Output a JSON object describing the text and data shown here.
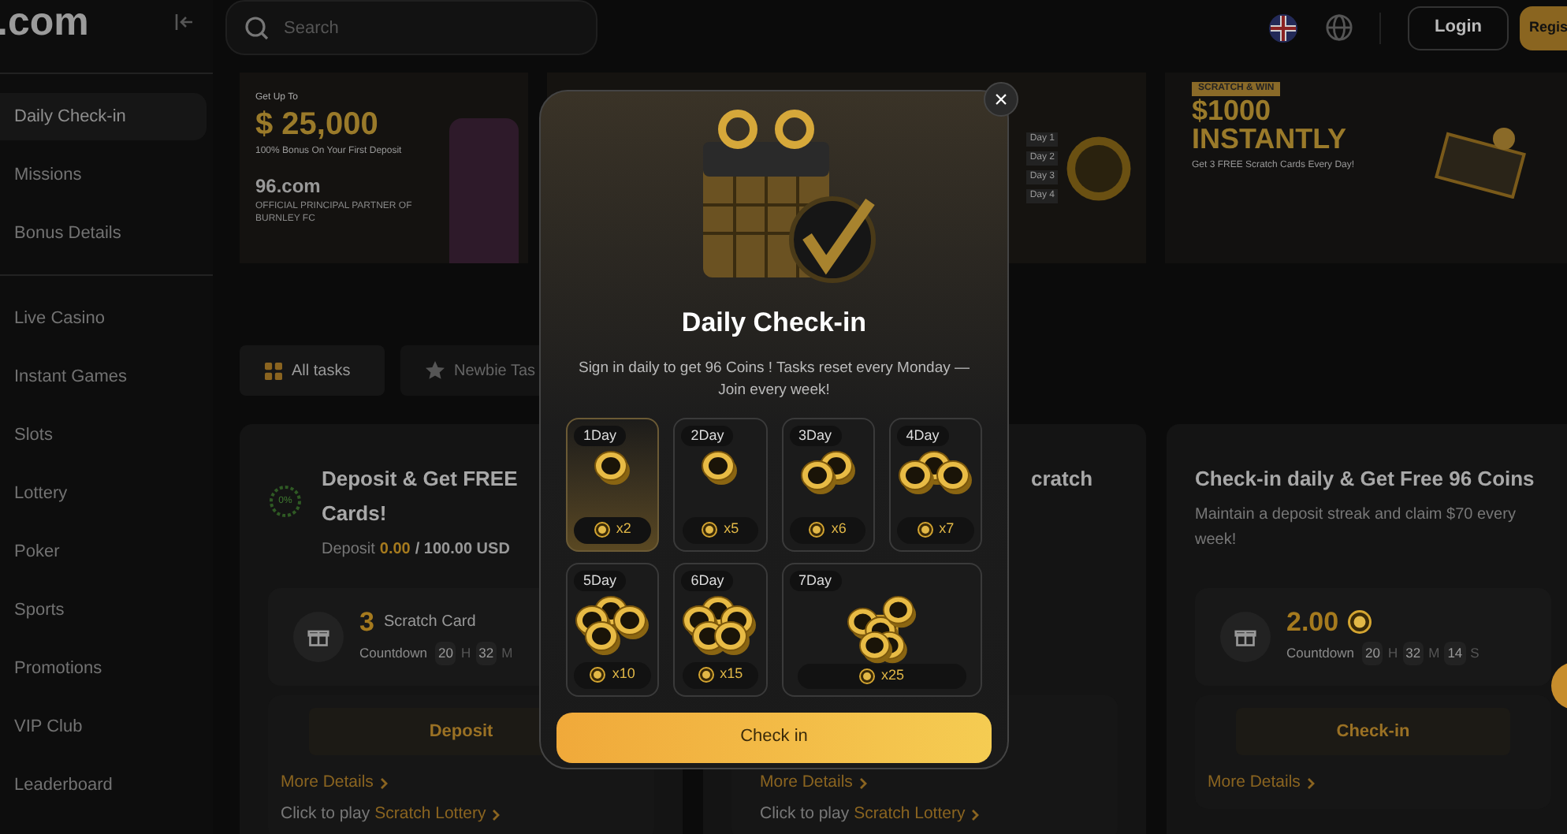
{
  "header": {
    "logo": ".com",
    "search": {
      "placeholder": "Search"
    },
    "login": "Login",
    "register": "Regis"
  },
  "sidebar": {
    "groups": [
      [
        {
          "label": "Daily Check-in",
          "selected": true
        },
        {
          "label": "Missions",
          "selected": false
        },
        {
          "label": "Bonus Details",
          "selected": false
        }
      ],
      [
        {
          "label": "Live Casino",
          "selected": false
        },
        {
          "label": "Instant Games",
          "selected": false
        },
        {
          "label": "Slots",
          "selected": false
        },
        {
          "label": "Lottery",
          "selected": false
        },
        {
          "label": "Poker",
          "selected": false
        },
        {
          "label": "Sports",
          "selected": false
        },
        {
          "label": "Promotions",
          "selected": false
        },
        {
          "label": "VIP Club",
          "selected": false
        },
        {
          "label": "Leaderboard",
          "selected": false
        }
      ]
    ]
  },
  "banners": {
    "first": {
      "eyebrow": "Get Up To",
      "amount": "$ 25,000",
      "subtitle": "100% Bonus On Your First Deposit",
      "brand": "96.com",
      "partner": "OFFICIAL PRINCIPAL PARTNER OF BURNLEY FC"
    },
    "second": {
      "days": [
        "Day 1",
        "Day 2",
        "Day 3",
        "Day 4"
      ]
    },
    "third": {
      "tag": "SCRATCH & WIN",
      "amount": "$1000",
      "headline": "INSTANTLY",
      "subtitle": "Get 3 FREE Scratch Cards Every Day!"
    }
  },
  "tabs": [
    {
      "label": "All tasks",
      "selected": true
    },
    {
      "label": "Newbie Tas",
      "selected": false
    }
  ],
  "cards": [
    {
      "title": "Deposit & Get FREE Cards!",
      "progress": {
        "ring": "0%",
        "label": "Deposit",
        "current": "0.00",
        "total": "/ 100.00 USD"
      },
      "reward": {
        "amount": "3",
        "unit": "Scratch Card",
        "kind": "cards"
      },
      "countdown": {
        "label": "Countdown",
        "parts": [
          {
            "value": "20",
            "unit": "H"
          },
          {
            "value": "32",
            "unit": "M"
          }
        ]
      },
      "action": "Deposit",
      "more": "More Details",
      "play": {
        "prefix": "Click to play",
        "link": "Scratch Lottery"
      }
    },
    {
      "title": "cratch",
      "more": "More Details",
      "play": {
        "prefix": "Click to play",
        "link": "Scratch Lottery"
      }
    },
    {
      "title": "Check-in daily & Get Free 96 Coins",
      "description": "Maintain a deposit streak and claim $70 every week!",
      "reward": {
        "amount": "2.00",
        "kind": "coins"
      },
      "countdown": {
        "label": "Countdown",
        "parts": [
          {
            "value": "20",
            "unit": "H"
          },
          {
            "value": "32",
            "unit": "M"
          },
          {
            "value": "14",
            "unit": "S"
          }
        ]
      },
      "action": "Check-in",
      "more": "More Details"
    }
  ],
  "modal": {
    "close": "×",
    "title": "Daily Check-in",
    "description": "Sign in daily to get 96 Coins ! Tasks reset every Monday — Join every week!",
    "days": [
      {
        "label": "1Day",
        "reward": "x2",
        "kind": "small",
        "selected": true
      },
      {
        "label": "2Day",
        "reward": "x5",
        "kind": "small",
        "selected": false
      },
      {
        "label": "3Day",
        "reward": "x6",
        "kind": "small",
        "selected": false
      },
      {
        "label": "4Day",
        "reward": "x7",
        "kind": "small",
        "selected": false
      },
      {
        "label": "5Day",
        "reward": "x10",
        "kind": "small",
        "selected": false
      },
      {
        "label": "6Day",
        "reward": "x15",
        "kind": "small",
        "selected": false
      },
      {
        "label": "7Day",
        "reward": "x25",
        "kind": "large",
        "selected": false
      }
    ],
    "button": "Check in"
  }
}
